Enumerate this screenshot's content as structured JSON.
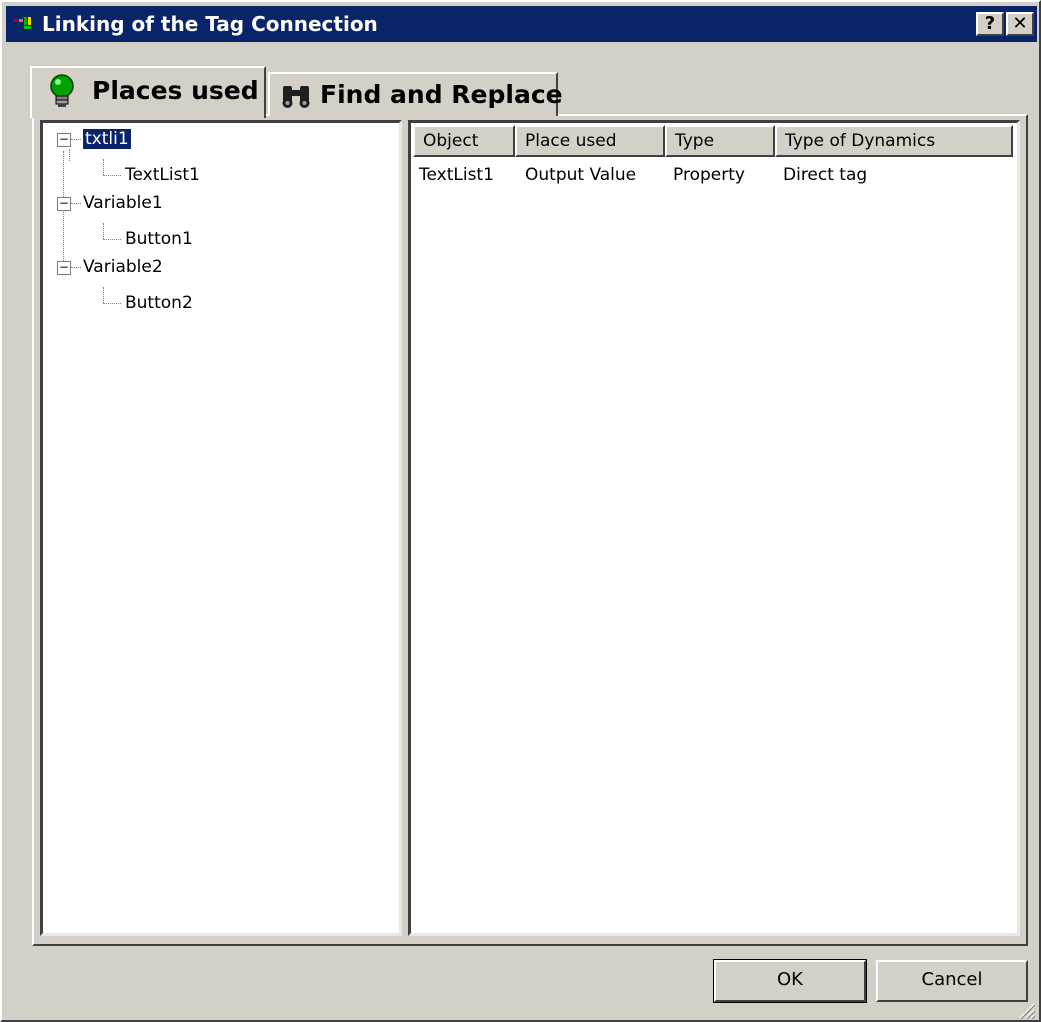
{
  "window": {
    "title": "Linking of the Tag Connection",
    "help_label": "?",
    "close_label": "✕"
  },
  "tabs": [
    {
      "label": "Places used",
      "icon": "lightbulb-icon",
      "active": true
    },
    {
      "label": "Find and Replace",
      "icon": "binoculars-icon",
      "active": false
    }
  ],
  "tree": {
    "nodes": [
      {
        "label": "txtli1",
        "level": 0,
        "expanded": true,
        "selected": true
      },
      {
        "label": "TextList1",
        "level": 1
      },
      {
        "label": "Variable1",
        "level": 0,
        "expanded": true
      },
      {
        "label": "Button1",
        "level": 1
      },
      {
        "label": "Variable2",
        "level": 0,
        "expanded": true
      },
      {
        "label": "Button2",
        "level": 1
      }
    ],
    "toggle_symbol": "−"
  },
  "list": {
    "columns": [
      "Object",
      "Place used",
      "Type",
      "Type of Dynamics"
    ],
    "rows": [
      [
        "TextList1",
        "Output Value",
        "Property",
        "Direct tag"
      ]
    ]
  },
  "buttons": {
    "ok_label": "OK",
    "cancel_label": "Cancel"
  },
  "colors": {
    "titlebar": "#0a246a",
    "face": "#d4d0c8",
    "selection": "#0a246a"
  }
}
